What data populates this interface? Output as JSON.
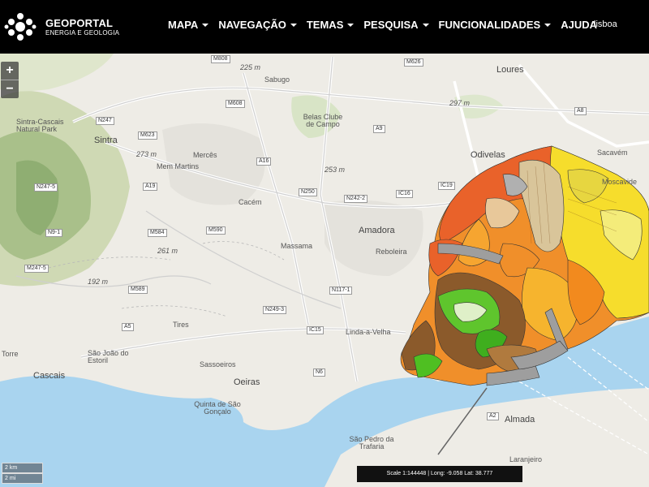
{
  "header": {
    "brand_title": "GEOPORTAL",
    "brand_sub": "ENERGIA E GEOLOGIA",
    "nav": [
      {
        "label": "MAPA"
      },
      {
        "label": "NAVEGAÇÃO"
      },
      {
        "label": "TEMAS"
      },
      {
        "label": "PESQUISA"
      },
      {
        "label": "FUNCIONALIDADES"
      }
    ],
    "help": "AJUDA",
    "user": "lisboa"
  },
  "map": {
    "places": {
      "loures": "Loures",
      "sabugo": "Sabugo",
      "sintra": "Sintra",
      "park": "Sintra-Cascais Natural Park",
      "merces": "Mercês",
      "mem_martins": "Mem Martins",
      "odivelas": "Odivelas",
      "sacavem": "Sacavém",
      "moscavide": "Moscavide",
      "belas": "Belas Clube de Campo",
      "cacem": "Cacém",
      "amadora": "Amadora",
      "reboleira": "Reboleira",
      "massama": "Massama",
      "tires": "Tires",
      "linda": "Linda-a-Velha",
      "torre": "Torre",
      "sao_joao": "São João do Estoril",
      "cascais": "Cascais",
      "sassoeiros": "Sassoeiros",
      "oeiras": "Oeiras",
      "quinta": "Quinta de São Gonçalo",
      "almada": "Almada",
      "sao_pedro": "São Pedro da Trafaria",
      "laranjeiro": "Laranjeiro"
    },
    "roads": [
      "M808",
      "M626",
      "M608",
      "N247",
      "M623",
      "A16",
      "A9",
      "A19",
      "A8",
      "N250",
      "N242-2",
      "IC16",
      "IC19",
      "N9-1",
      "N247-5",
      "M590",
      "M584",
      "M589",
      "M247-5",
      "N117-1",
      "N249-3",
      "N6",
      "IC15",
      "A2",
      "A5"
    ],
    "elevations": [
      "225 m",
      "273 m",
      "297 m",
      "261 m",
      "192 m",
      "253 m"
    ],
    "scale_km": "2 km",
    "scale_mi": "2 mi",
    "status": "Scale 1:144448 | Long: -9.058 Lat: 38.777",
    "zoom_in": "+",
    "zoom_out": "−"
  }
}
